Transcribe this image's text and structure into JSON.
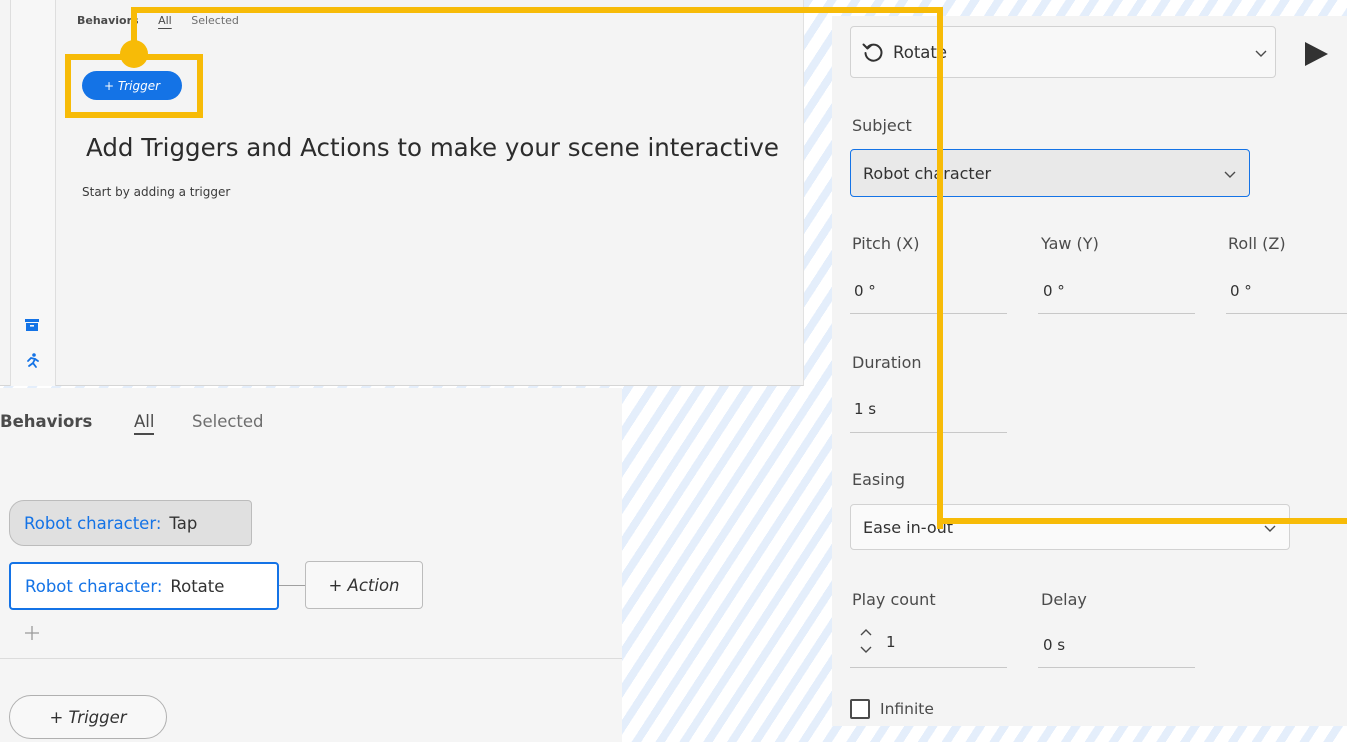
{
  "colors": {
    "accent": "#1473e6",
    "highlight": "#f7bb07",
    "panel_bg": "#f4f4f4"
  },
  "top_panel": {
    "tabs": {
      "behaviors": "Behaviors",
      "all": "All",
      "selected": "Selected"
    },
    "trigger_button": "+ Trigger",
    "heading": "Add Triggers and Actions to make your scene interactive",
    "subheading": "Start by adding a trigger",
    "rail_icons": [
      "archive-icon",
      "running-figure-icon"
    ]
  },
  "bottom_panel": {
    "tabs": {
      "behaviors": "Behaviors",
      "all": "All",
      "selected": "Selected"
    },
    "trigger_item": {
      "subject": "Robot character:",
      "event": "Tap"
    },
    "action_item": {
      "subject": "Robot character:",
      "action": "Rotate"
    },
    "add_action_button": "+ Action",
    "add_trigger_button": "+ Trigger"
  },
  "properties": {
    "action": "Rotate",
    "subject_label": "Subject",
    "subject_value": "Robot character",
    "pitch_label": "Pitch (X)",
    "pitch_value": "0 °",
    "yaw_label": "Yaw (Y)",
    "yaw_value": "0 °",
    "roll_label": "Roll (Z)",
    "roll_value": "0 °",
    "duration_label": "Duration",
    "duration_value": "1 s",
    "easing_label": "Easing",
    "easing_value": "Ease in-out",
    "play_count_label": "Play count",
    "play_count_value": "1",
    "delay_label": "Delay",
    "delay_value": "0 s",
    "infinite_label": "Infinite",
    "infinite_checked": false
  }
}
